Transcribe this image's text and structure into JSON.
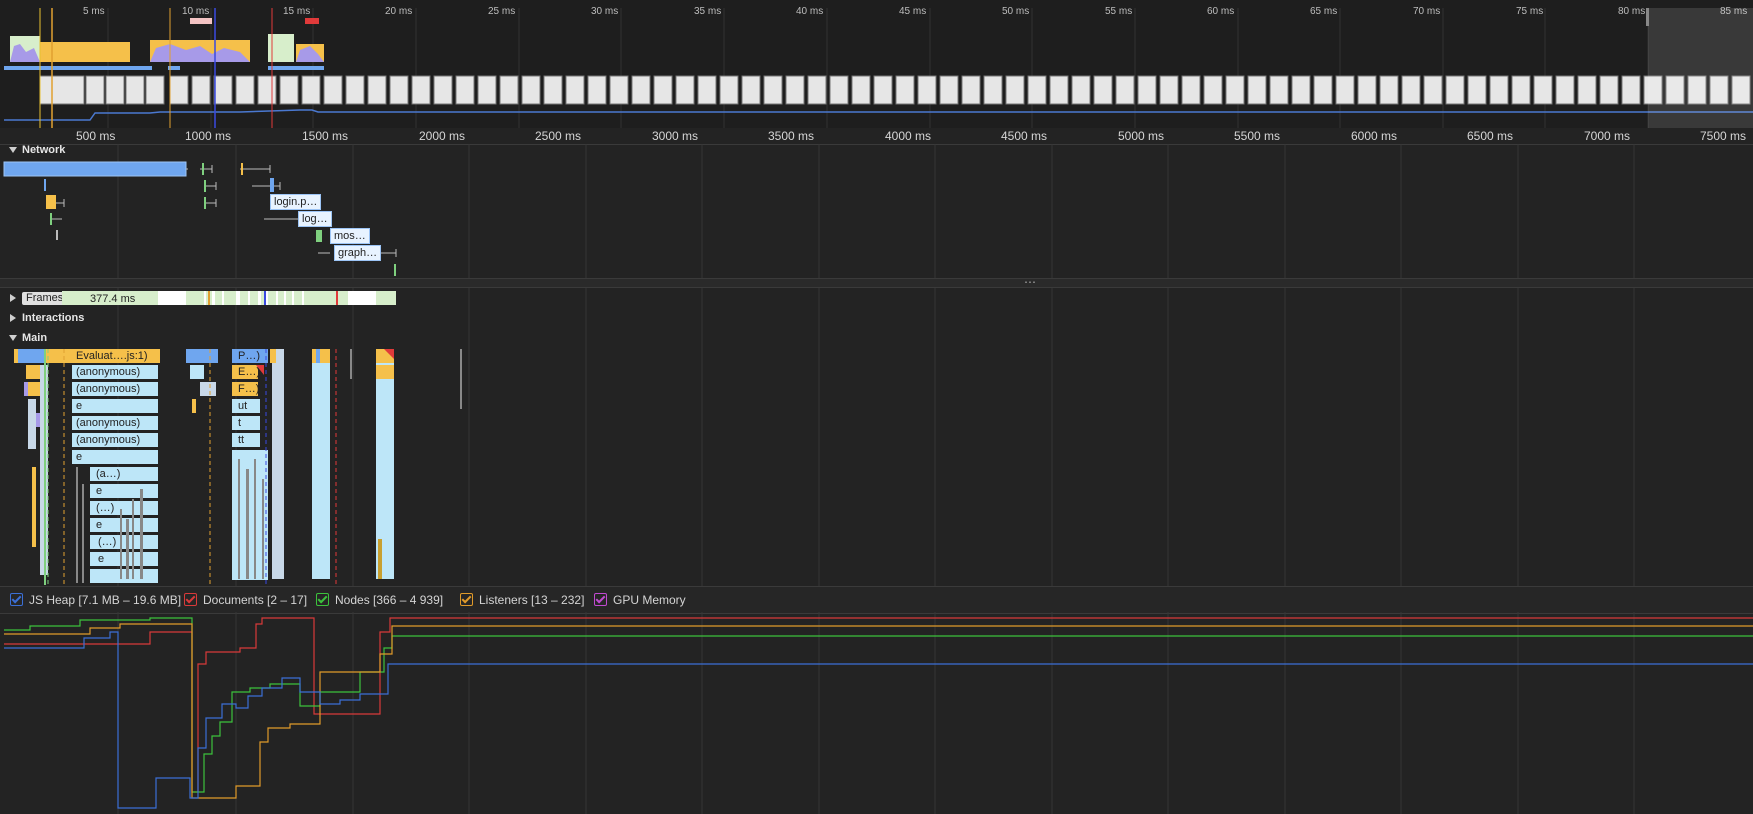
{
  "overview": {
    "ruler_ticks": [
      "5 ms",
      "10 ms",
      "15 ms",
      "20 ms",
      "25 ms",
      "30 ms",
      "35 ms",
      "40 ms",
      "45 ms",
      "50 ms",
      "55 ms",
      "60 ms",
      "65 ms",
      "70 ms",
      "75 ms",
      "80 ms",
      "85 ms"
    ]
  },
  "timeline": {
    "ruler_ticks": [
      "500 ms",
      "1000 ms",
      "1500 ms",
      "2000 ms",
      "2500 ms",
      "3000 ms",
      "3500 ms",
      "4000 ms",
      "4500 ms",
      "5000 ms",
      "5500 ms",
      "6000 ms",
      "6500 ms",
      "7000 ms",
      "7500 ms"
    ]
  },
  "network": {
    "title": "Network",
    "request_labels": [
      "login.p…",
      "log…",
      "mos…",
      "graph…"
    ]
  },
  "tracks": {
    "frames_title": "Frames",
    "frames_duration": "377.4 ms",
    "interactions_title": "Interactions",
    "main_title": "Main"
  },
  "flame": {
    "col1": [
      "Evaluat….js:1)",
      "(anonymous)",
      "(anonymous)",
      "e",
      "(anonymous)",
      "(anonymous)",
      "e",
      "(a…)",
      "e",
      "(…)",
      "e",
      "(…)",
      "e"
    ],
    "col2": [
      "P…)",
      "E…)",
      "F…)",
      "ut",
      "t",
      "tt"
    ]
  },
  "counters": {
    "js_heap": "JS Heap [7.1 MB – 19.6 MB]",
    "documents": "Documents [2 – 17]",
    "nodes": "Nodes [366 – 4 939]",
    "listeners": "Listeners [13 – 232]",
    "gpu_memory": "GPU Memory"
  },
  "colors": {
    "js_heap": "#3b6fd6",
    "documents": "#d83a3a",
    "nodes": "#3cc23c",
    "listeners": "#e09a2a",
    "gpu_memory": "#c04ad0",
    "scripting": "#f5c04a",
    "system": "#c8d8e8",
    "idle_frame": "#d7eecb",
    "network_bar": "#6fa6ef",
    "flame_call": "#bde6f8"
  }
}
